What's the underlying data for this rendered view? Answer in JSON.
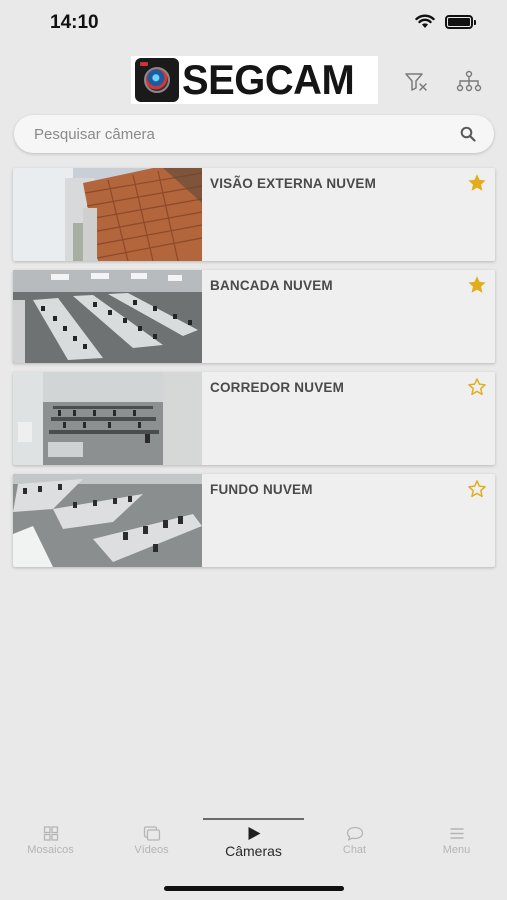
{
  "status": {
    "time": "14:10"
  },
  "header": {
    "brand": "SEGCAM"
  },
  "search": {
    "placeholder": "Pesquisar câmera"
  },
  "cameras": [
    {
      "name": "VISÃO EXTERNA NUVEM",
      "favorite": true
    },
    {
      "name": "BANCADA NUVEM",
      "favorite": true
    },
    {
      "name": "CORREDOR NUVEM",
      "favorite": false
    },
    {
      "name": "FUNDO NUVEM",
      "favorite": false
    }
  ],
  "tabs": [
    {
      "label": "Mosaicos",
      "icon": "grid-icon"
    },
    {
      "label": "Vídeos",
      "icon": "videos-icon"
    },
    {
      "label": "Câmeras",
      "icon": "play-icon",
      "active": true
    },
    {
      "label": "Chat",
      "icon": "chat-icon"
    },
    {
      "label": "Menu",
      "icon": "hamburger-icon"
    }
  ],
  "colors": {
    "star": "#e2ad1b",
    "background": "#e9e9e9"
  }
}
